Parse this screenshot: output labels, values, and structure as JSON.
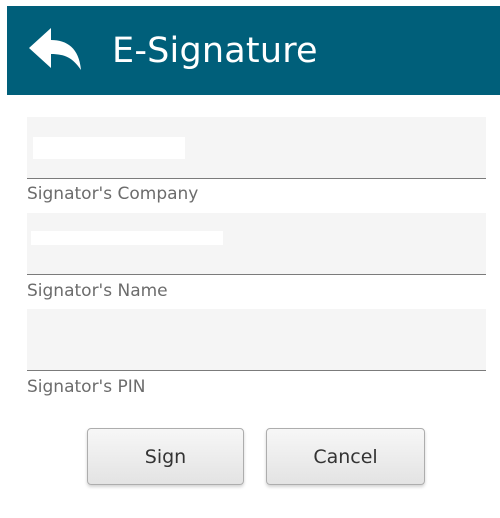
{
  "header": {
    "title": "E-Signature",
    "back_icon": "back-arrow-icon",
    "background_color": "#005f7a"
  },
  "form": {
    "company": {
      "label": "Signator's Company",
      "value": ""
    },
    "name": {
      "label": "Signator's Name",
      "value": ""
    },
    "pin": {
      "label": "Signator's PIN",
      "value": ""
    }
  },
  "buttons": {
    "sign_label": "Sign",
    "cancel_label": "Cancel"
  }
}
